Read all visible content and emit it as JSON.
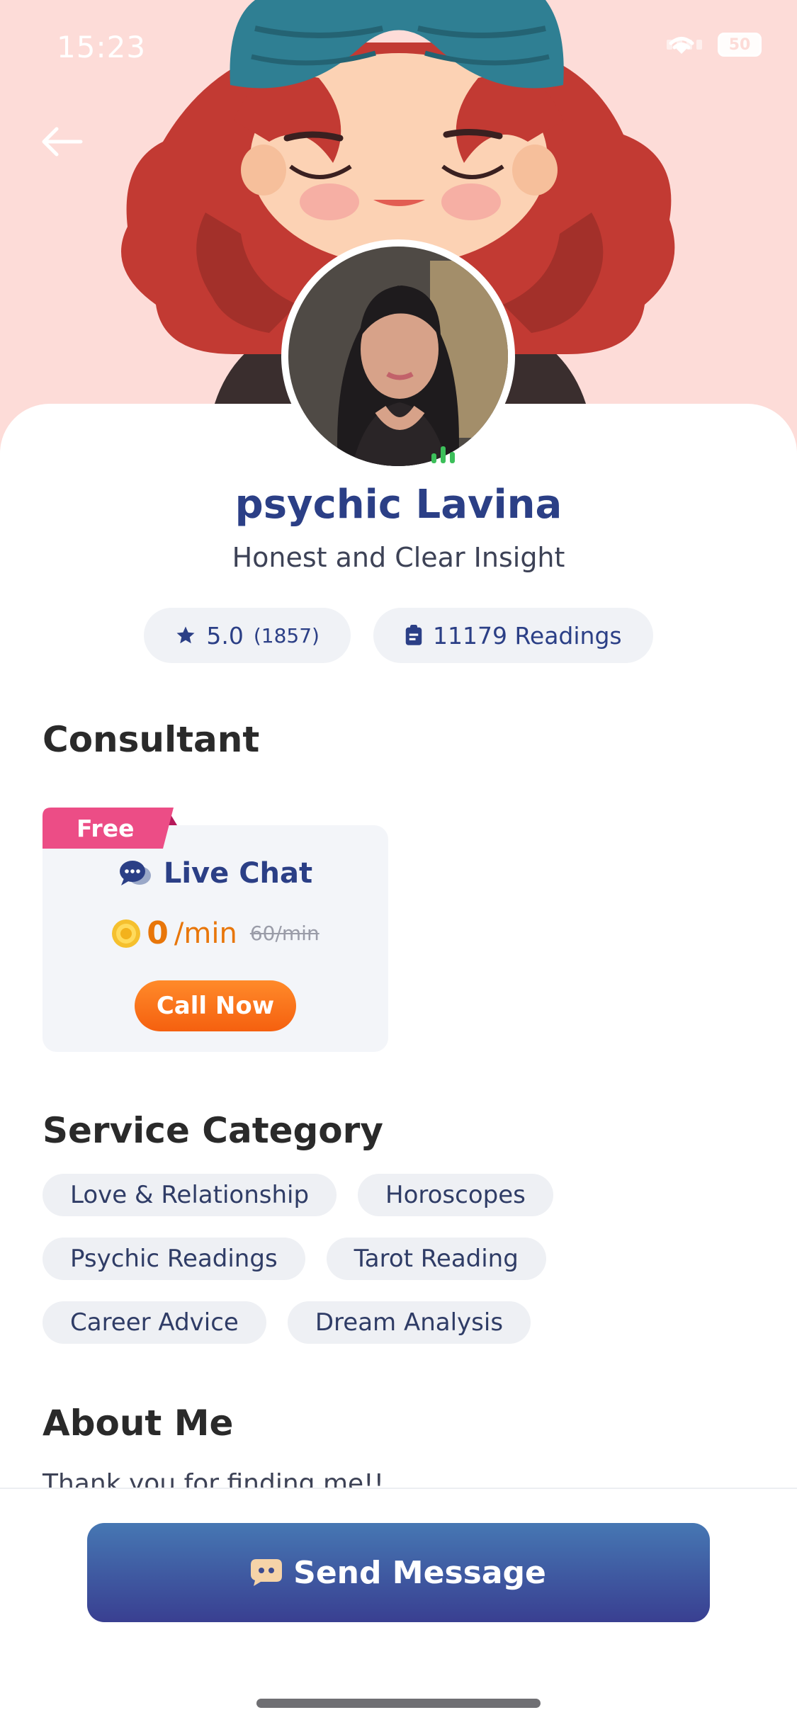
{
  "status_bar": {
    "time": "15:23",
    "battery": "50",
    "icons": [
      "signal-icon",
      "wifi-icon",
      "battery-icon"
    ]
  },
  "nav": {
    "back_icon": "arrow-left-icon"
  },
  "profile": {
    "name": "psychic Lavina",
    "tagline": "Honest and Clear Insight",
    "rating": "5.0",
    "rating_count": "(1857)",
    "readings": "11179 Readings",
    "online_indicator": "online-bars-icon"
  },
  "consultant": {
    "section_title": "Consultant",
    "free_badge": "Free",
    "service_name": "Live Chat",
    "price_value": "0",
    "price_unit": "/min",
    "old_price": "60/min",
    "call_button": "Call Now"
  },
  "service_category": {
    "section_title": "Service Category",
    "tags": [
      [
        "Love & Relationship",
        "Horoscopes"
      ],
      [
        "Psychic Readings",
        "Tarot Reading"
      ],
      [
        "Career Advice",
        "Dream Analysis"
      ]
    ]
  },
  "about": {
    "section_title": "About Me",
    "text": "Thank you for finding me!!"
  },
  "bottom": {
    "send_button": "Send Message"
  },
  "colors": {
    "header_bg": "#fddcd8",
    "brand_blue": "#2b3f86",
    "accent_orange": "#f5600f",
    "free_pink": "#e84a8a"
  }
}
